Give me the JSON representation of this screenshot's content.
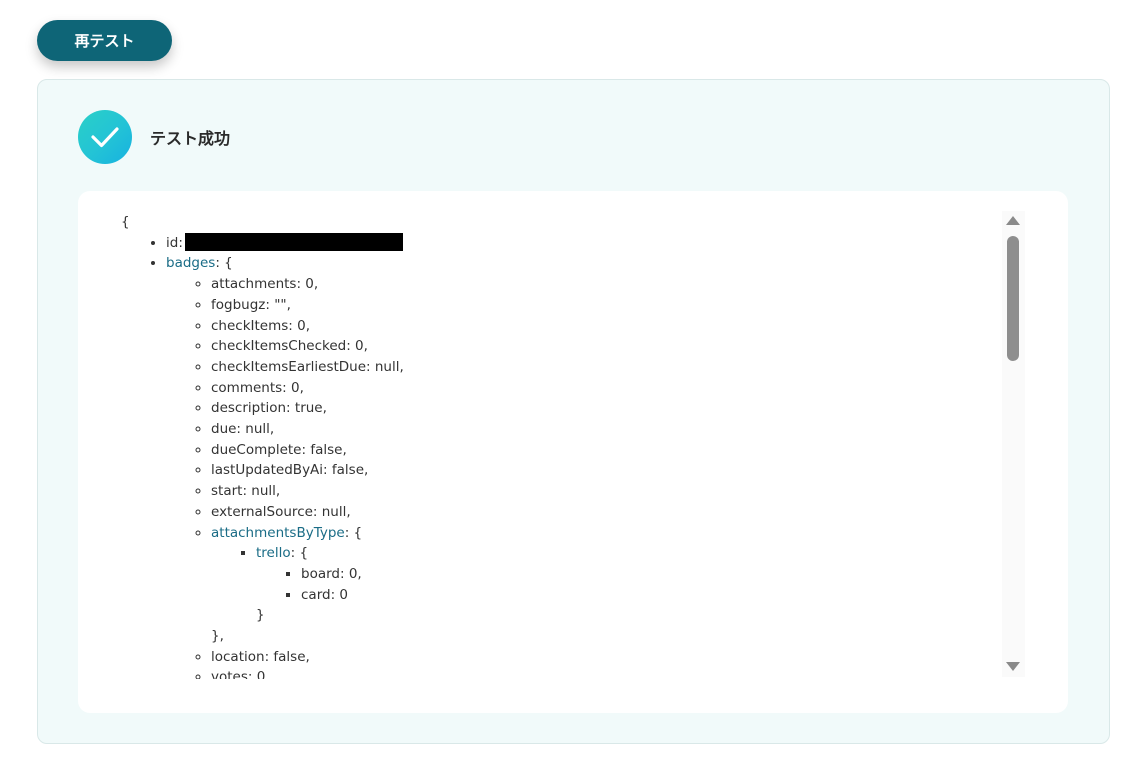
{
  "toolbar": {
    "retest_label": "再テスト"
  },
  "status": {
    "text": "テスト成功",
    "icon": "check-icon"
  },
  "json_view": {
    "open_brace": "{",
    "id_key": "id",
    "badges_key": "badges",
    "badges_items": [
      "attachments: 0,",
      "fogbugz: \"\",",
      "checkItems: 0,",
      "checkItemsChecked: 0,",
      "checkItemsEarliestDue: null,",
      "comments: 0,",
      "description: true,",
      "due: null,",
      "dueComplete: false,",
      "lastUpdatedByAi: false,",
      "start: null,",
      "externalSource: null,"
    ],
    "attachments_by_type_key": "attachmentsByType",
    "trello_key": "trello",
    "trello_items": [
      "board: 0,",
      "card: 0"
    ],
    "after_items": [
      "location: false,",
      "votes: 0"
    ]
  },
  "colors": {
    "button_bg": "#0e6577",
    "panel_bg": "#f1fafa",
    "object_key": "#1a6c86",
    "check_gradient_start": "#2ad0c7",
    "check_gradient_end": "#17b1e0"
  }
}
